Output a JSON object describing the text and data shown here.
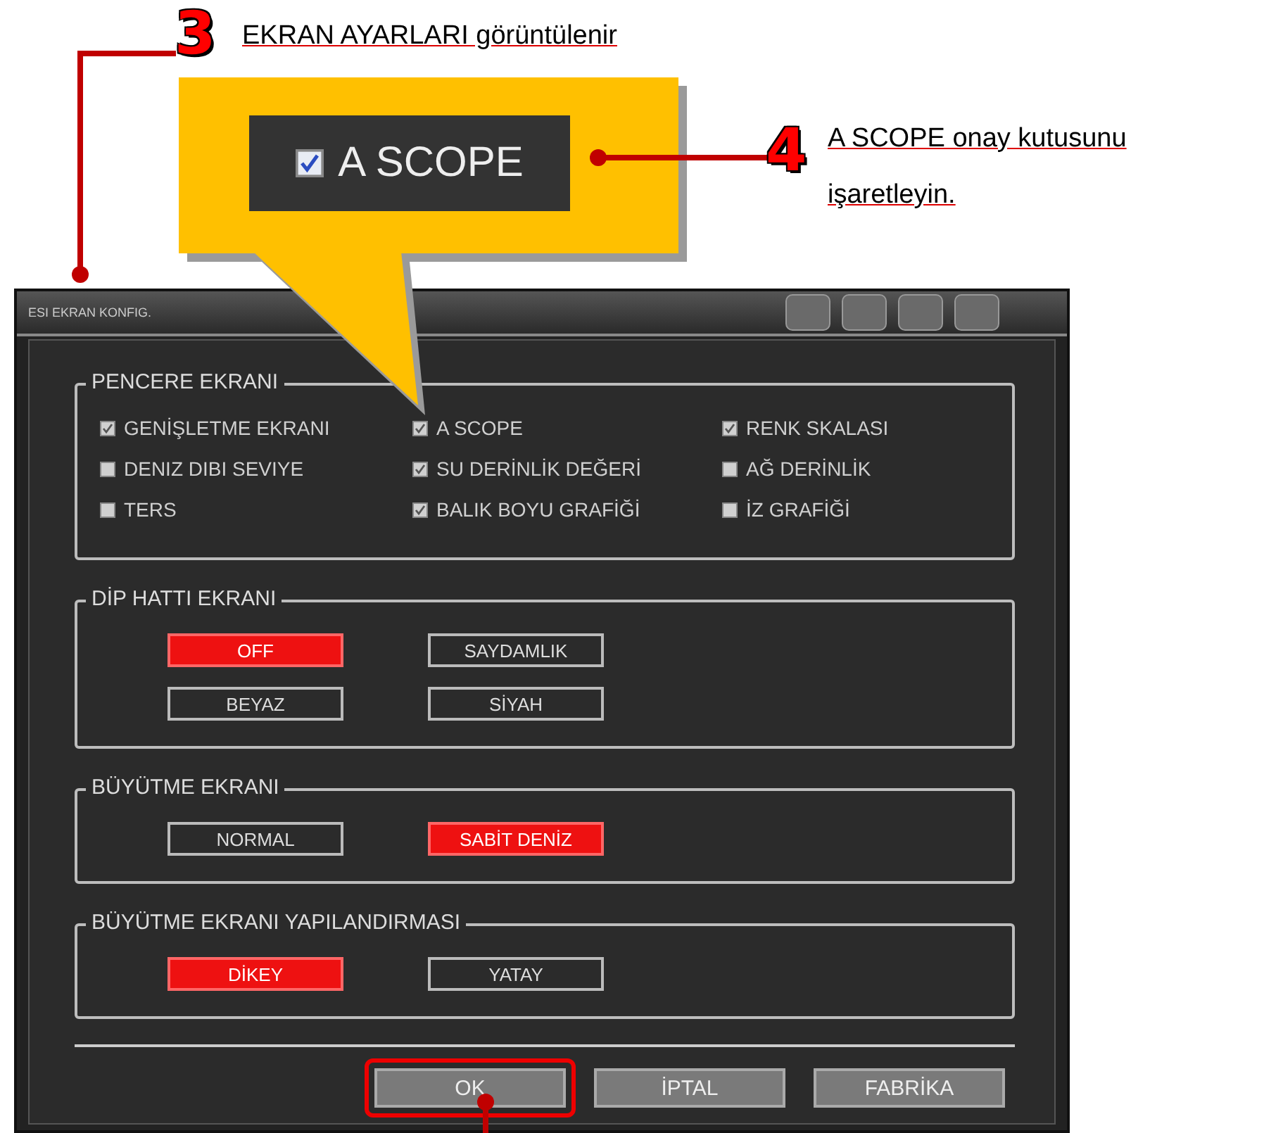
{
  "annotations": [
    {
      "number": "3",
      "lines": [
        "EKRAN AYARLARI görüntülenir"
      ]
    },
    {
      "number": "4",
      "lines": [
        "A SCOPE onay kutusunu",
        "işaretleyin."
      ]
    }
  ],
  "callout": {
    "label": "A SCOPE",
    "checked": true
  },
  "dialog": {
    "title": "ESI EKRAN KONFIG.",
    "sections": [
      {
        "kind": "checkboxes",
        "title": "PENCERE EKRANI",
        "items": [
          {
            "label": "GENİŞLETME EKRANI",
            "checked": true
          },
          {
            "label": "A SCOPE",
            "checked": true
          },
          {
            "label": "RENK SKALASI",
            "checked": true
          },
          {
            "label": "DENIZ DIBI SEVIYE",
            "checked": false
          },
          {
            "label": "SU DERİNLİK DEĞERİ",
            "checked": true
          },
          {
            "label": "AĞ DERİNLİK",
            "checked": false
          },
          {
            "label": "TERS",
            "checked": false
          },
          {
            "label": "BALIK BOYU GRAFİĞİ",
            "checked": true
          },
          {
            "label": "İZ GRAFİĞİ",
            "checked": false
          }
        ]
      },
      {
        "kind": "options",
        "title": "DİP HATTI EKRANI",
        "items": [
          {
            "label": "OFF",
            "selected": true
          },
          {
            "label": "SAYDAMLIK",
            "selected": false
          },
          {
            "label": "BEYAZ",
            "selected": false
          },
          {
            "label": "SİYAH",
            "selected": false
          }
        ]
      },
      {
        "kind": "options",
        "title": "BÜYÜTME EKRANI",
        "items": [
          {
            "label": "NORMAL",
            "selected": false
          },
          {
            "label": "SABİT DENİZ",
            "selected": true
          }
        ]
      },
      {
        "kind": "options",
        "title": "BÜYÜTME EKRANI YAPILANDIRMASI",
        "items": [
          {
            "label": "DİKEY",
            "selected": true
          },
          {
            "label": "YATAY",
            "selected": false
          }
        ]
      }
    ],
    "buttons": [
      {
        "label": "OK",
        "highlighted": true
      },
      {
        "label": "İPTAL",
        "highlighted": false
      },
      {
        "label": "FABRİKA",
        "highlighted": false
      }
    ]
  }
}
